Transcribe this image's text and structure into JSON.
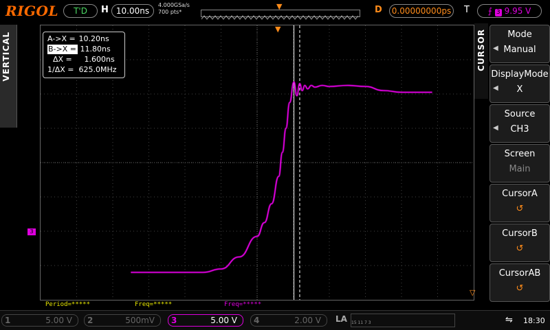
{
  "brand": "RIGOL",
  "trigger_state": "T'D",
  "h_label": "H",
  "timebase": "10.00ns",
  "sample_rate": "4.000GSa/s",
  "memory_depth": "700 pts*",
  "delay_label": "D",
  "delay_value": "0.00000000ps",
  "trigger_label": "T",
  "trigger_channel": "3",
  "trigger_level": "9.95 V",
  "side_tab": "VERTICAL",
  "cursor_tab": "CURSOR",
  "measure": {
    "ax_label": "A->X =",
    "ax_value": "10.20ns",
    "bx_label": "B->X =",
    "bx_value": "11.80ns",
    "dx_label": "ΔX =",
    "dx_value": "1.600ns",
    "inv_label": "1/ΔX =",
    "inv_value": "625.0MHz"
  },
  "menu": {
    "mode_title": "Mode",
    "mode_value": "Manual",
    "display_title": "DisplayMode",
    "display_value": "X",
    "source_title": "Source",
    "source_value": "CH3",
    "screen_title": "Screen",
    "screen_value": "Main",
    "cursora_title": "CursorA",
    "cursorb_title": "CursorB",
    "cursorab_title": "CursorAB"
  },
  "stats": {
    "period": "Period=*****",
    "freq1": "Freq=*****",
    "freq2": "Freq=*****"
  },
  "channels": {
    "ch1_num": "1",
    "ch1_val": "5.00 V",
    "ch2_num": "2",
    "ch2_val": "500mV",
    "ch3_num": "3",
    "ch3_val": "5.00 V",
    "ch4_num": "4",
    "ch4_val": "2.00 V"
  },
  "la_label": "LA",
  "la_nums": "15  11  7  3",
  "time": "18:30",
  "colors": {
    "ch3": "#e000e0",
    "accent": "#ff8c1a",
    "trig_ok": "#4cd964"
  },
  "waveform": {
    "channel": "CH3",
    "points_t_ns": [
      -35,
      -15,
      -10,
      -5,
      0,
      2,
      4,
      6,
      7,
      8,
      9,
      10.2,
      11,
      11.8,
      12.5,
      13.2,
      14,
      15,
      16,
      18,
      20,
      25,
      30,
      35,
      40,
      48.5
    ],
    "points_v_div": [
      -3.2,
      -3.2,
      -3.1,
      -2.75,
      -2.15,
      -1.75,
      -1.2,
      -0.4,
      0.3,
      1.0,
      1.75,
      2.35,
      1.95,
      2.3,
      2.1,
      2.25,
      2.15,
      2.25,
      2.2,
      2.25,
      2.22,
      2.25,
      2.22,
      2.1,
      2.05,
      2.05
    ]
  },
  "cursor_a_ns": 10.2,
  "cursor_b_ns": 11.8
}
